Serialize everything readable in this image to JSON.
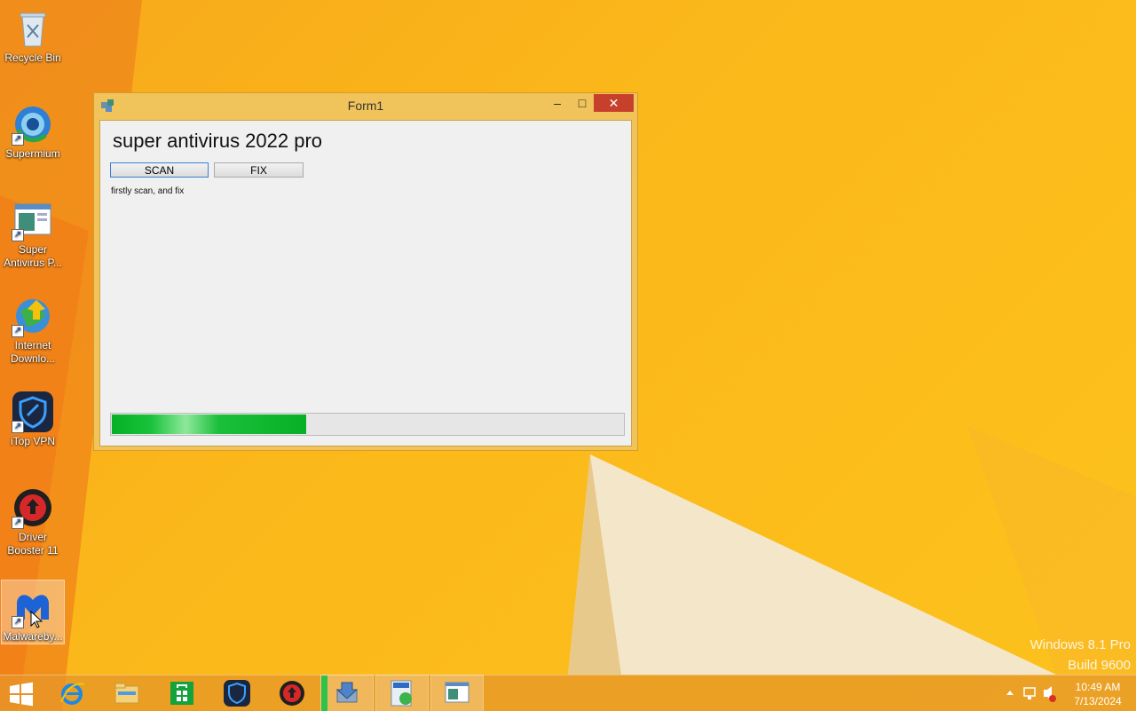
{
  "desktop": {
    "icons": [
      {
        "label": "Recycle Bin",
        "icon": "recycle-bin-icon"
      },
      {
        "label": "Supermium",
        "icon": "supermium-icon"
      },
      {
        "label": "Super Antivirus P...",
        "icon": "app-window-icon"
      },
      {
        "label": "Internet Downlo...",
        "icon": "internet-download-manager-icon"
      },
      {
        "label": "iTop VPN",
        "icon": "itop-vpn-icon"
      },
      {
        "label": "Driver Booster 11",
        "icon": "driver-booster-icon"
      },
      {
        "label": "Malwareby...",
        "icon": "malwarebytes-icon"
      }
    ],
    "watermark": {
      "line1": "Windows 8.1 Pro",
      "line2": "Build 9600"
    }
  },
  "window": {
    "title": "Form1",
    "controls": {
      "minimize": "–",
      "maximize": "□",
      "close": "✕"
    },
    "heading": "super antivirus 2022 pro",
    "scan_label": "SCAN",
    "fix_label": "FIX",
    "hint": "firstly scan, and fix",
    "progress_percent": 38
  },
  "taskbar": {
    "items": [
      "start-icon",
      "internet-explorer-icon",
      "file-explorer-icon",
      "store-icon",
      "itop-vpn-icon",
      "driver-booster-icon",
      "installer-icon",
      "iobit-icon",
      "form-window-icon"
    ],
    "clock_time": "10:49 AM",
    "clock_date": "7/13/2024",
    "colors": {
      "accent": "#f7a81b",
      "progress": "#06b025",
      "close": "#c7402b"
    }
  }
}
